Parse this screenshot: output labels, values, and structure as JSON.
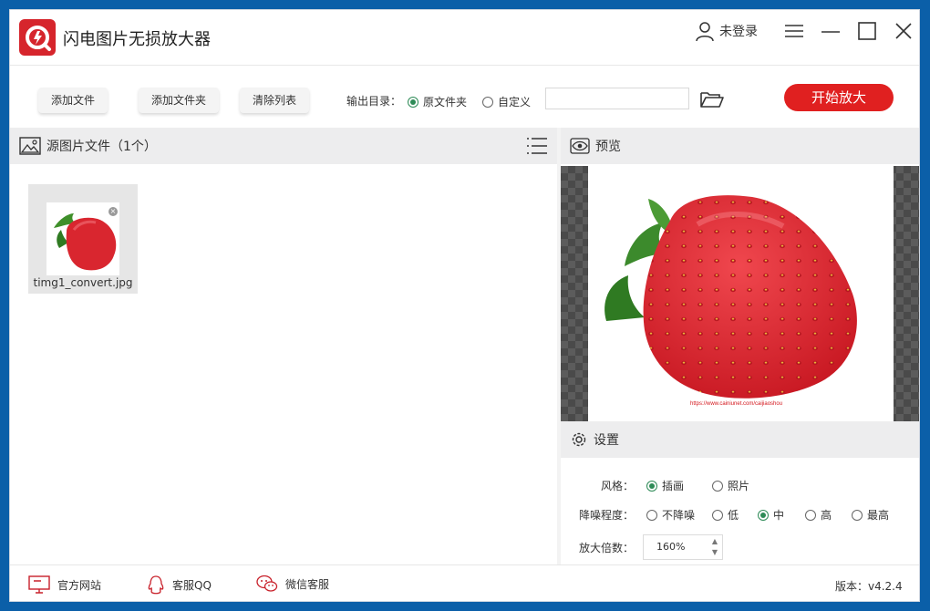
{
  "app": {
    "title": "闪电图片无损放大器"
  },
  "header": {
    "user_label": "未登录"
  },
  "toolbar": {
    "add_file": "添加文件",
    "add_folder": "添加文件夹",
    "clear_list": "清除列表",
    "output_label": "输出目录：",
    "output_options": [
      {
        "label": "原文件夹",
        "selected": true
      },
      {
        "label": "自定义",
        "selected": false
      }
    ],
    "path_value": "",
    "start_label": "开始放大"
  },
  "source_panel": {
    "title": "源图片文件（1个）",
    "files": [
      {
        "name": "timg1_convert.jpg"
      }
    ]
  },
  "preview_panel": {
    "title": "预览",
    "watermark_text": "https://www.cainiunet.com/caijiaoshou"
  },
  "settings_panel": {
    "title": "设置",
    "style_label": "风格：",
    "style_options": [
      {
        "label": "插画",
        "selected": true
      },
      {
        "label": "照片",
        "selected": false
      }
    ],
    "noise_label": "降噪程度：",
    "noise_options": [
      {
        "label": "不降噪",
        "selected": false
      },
      {
        "label": "低",
        "selected": false
      },
      {
        "label": "中",
        "selected": true
      },
      {
        "label": "高",
        "selected": false
      },
      {
        "label": "最高",
        "selected": false
      }
    ],
    "scale_label": "放大倍数：",
    "scale_value": "160%"
  },
  "footer": {
    "website": "官方网站",
    "qq": "客服QQ",
    "wechat": "微信客服",
    "version": "版本：v4.2.4"
  },
  "colors": {
    "accent": "#e02020",
    "radio_selected": "#2e8b57",
    "panel_header": "#ededee"
  }
}
